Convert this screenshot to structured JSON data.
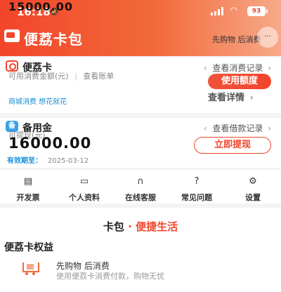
{
  "status": {
    "time": "16:18",
    "battery": "93"
  },
  "app": {
    "title": "便荔卡包",
    "capsule_text": "先购物 后消费",
    "capsule_btn": "···"
  },
  "card1": {
    "name": "便荔卡",
    "record_link": "查看消费记录",
    "balance_label": "可用消费金额(元)",
    "bill_link": "查看账单",
    "amount": "15000.00",
    "tagline": "商城消费  想花就花",
    "quota_button": "使用额度",
    "detail_link": "查看详情"
  },
  "card2": {
    "icon_text": "备",
    "name": "备用金",
    "record_link": "查看借款记录",
    "balance_label": "可提现(元)",
    "amount": "16000.00",
    "withdraw_button": "立即提现",
    "expire_label": "有效期至：",
    "expire_value": "2025-03-12"
  },
  "menu": [
    {
      "label": "开发票",
      "icon": "invoice-icon"
    },
    {
      "label": "个人资料",
      "icon": "profile-icon"
    },
    {
      "label": "在线客服",
      "icon": "headset-icon"
    },
    {
      "label": "常见问题",
      "icon": "question-icon"
    },
    {
      "label": "设置",
      "icon": "gear-icon"
    }
  ],
  "slogan": {
    "a": "卡包",
    "sep": " · ",
    "b": "便捷生活"
  },
  "rights": {
    "title": "便荔卡权益",
    "item_name": "先购物 后消费",
    "item_desc": "使用便荔卡消费付款，购物无忧"
  },
  "colors": {
    "brand": "#f2452b",
    "accent_blue": "#1a8fd8"
  }
}
